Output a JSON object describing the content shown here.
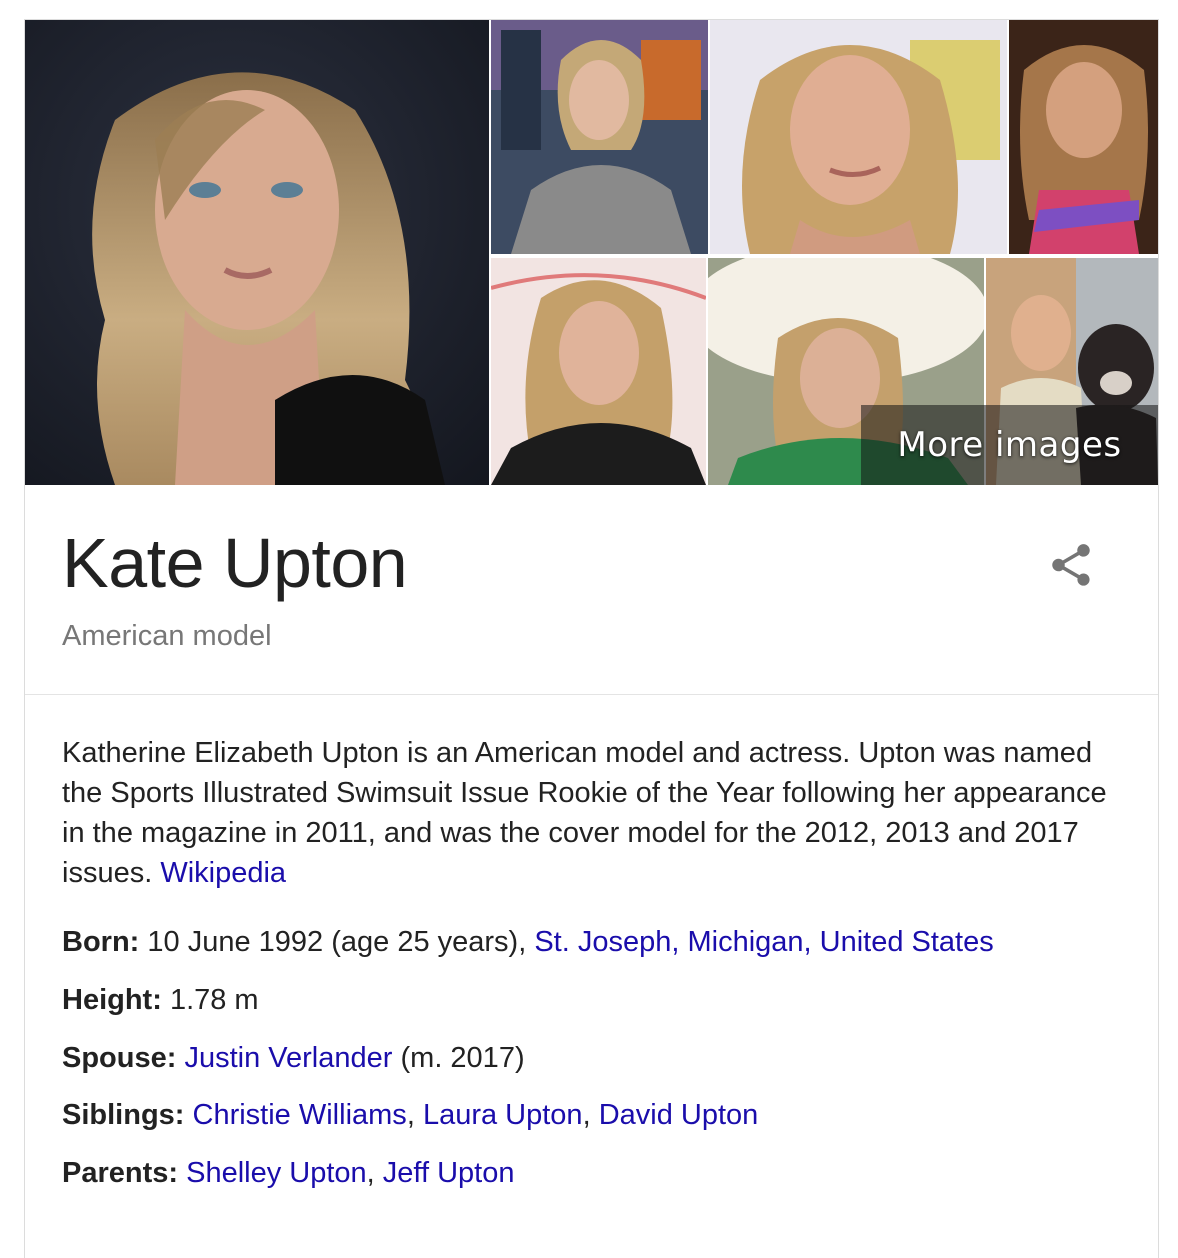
{
  "images": {
    "more_label": "More images"
  },
  "entity": {
    "name": "Kate Upton",
    "subtitle": "American model"
  },
  "description": {
    "text": "Katherine Elizabeth Upton is an American model and actress. Upton was named the Sports Illustrated Swimsuit Issue Rookie of the Year following her appearance in the magazine in 2011, and was the cover model for the 2012, 2013 and 2017 issues.",
    "source_link": "Wikipedia"
  },
  "facts": {
    "born": {
      "label": "Born:",
      "value": "10 June 1992 (age 25 years),",
      "link": "St. Joseph, Michigan, United States"
    },
    "height": {
      "label": "Height:",
      "value": "1.78 m"
    },
    "spouse": {
      "label": "Spouse:",
      "link": "Justin Verlander",
      "suffix": "(m. 2017)"
    },
    "siblings": {
      "label": "Siblings:",
      "links": [
        "Christie Williams",
        "Laura Upton",
        "David Upton"
      ],
      "separator": ", "
    },
    "parents": {
      "label": "Parents:",
      "links": [
        "Shelley Upton",
        "Jeff Upton"
      ],
      "separator": ", "
    }
  },
  "colors": {
    "link": "#1a0dab",
    "subtitle": "#777777",
    "text": "#222222"
  }
}
